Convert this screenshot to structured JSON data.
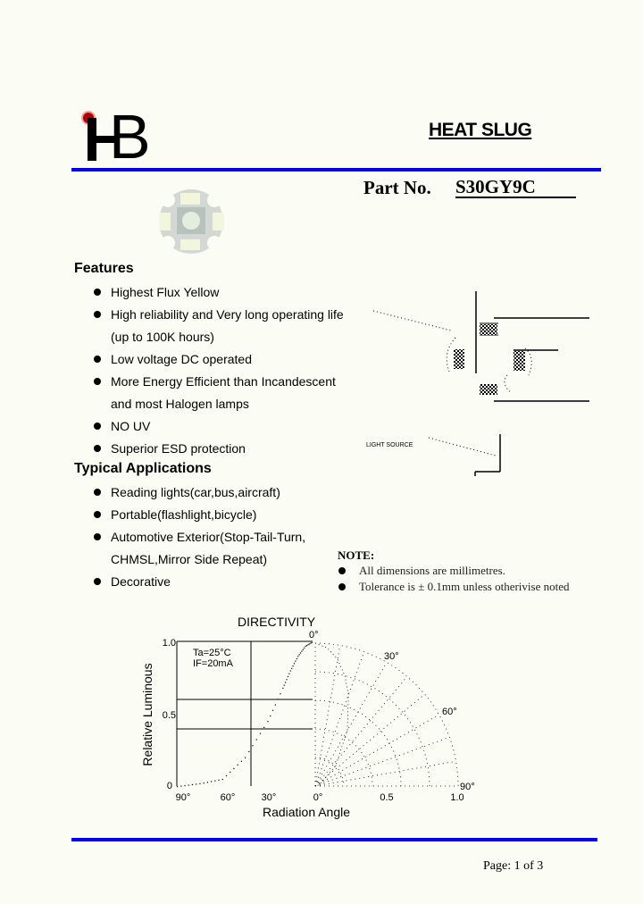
{
  "header": {
    "logo_text": "HB",
    "title": "HEAT SLUG",
    "part_label": "Part  No.",
    "part_number": "S30GY9C",
    "colors": {
      "rule": "#0000f0",
      "logo_sun": "#b00000",
      "background": "#fbfcf3"
    }
  },
  "product_image": {
    "icon": "led-star-board-image"
  },
  "features": {
    "heading": "Features",
    "items": [
      "Highest Flux Yellow",
      "High reliability and Very long operating life",
      "(up to 100K hours)",
      "Low voltage DC operated",
      "More Energy Efficient than Incandescent",
      "and most Halogen lamps",
      "NO UV",
      "Superior ESD protection"
    ],
    "bulleted": [
      true,
      true,
      false,
      true,
      true,
      false,
      true,
      true
    ]
  },
  "applications": {
    "heading": "Typical Applications",
    "items": [
      "Reading lights(car,bus,aircraft)",
      "Portable(flashlight,bicycle)",
      "Automotive Exterior(Stop-Tail-Turn,",
      "CHMSL,Mirror Side Repeat)",
      "Decorative"
    ],
    "bulleted": [
      true,
      true,
      true,
      false,
      true
    ]
  },
  "drawing": {
    "labels": [
      "LIGHT SOURCE"
    ]
  },
  "note": {
    "heading": "NOTE:",
    "items": [
      "All dimensions are millimetres.",
      "Tolerance is ± 0.1mm unless otherivise noted"
    ]
  },
  "chart_data": {
    "type": "line",
    "title": "DIRECTIVITY",
    "xlabel": "Radiation Angle",
    "ylabel": "Relative Luminous",
    "conditions": [
      "Ta=25°C",
      "IF=20mA"
    ],
    "left_panel": {
      "x_ticks": [
        "90°",
        "60°",
        "30°",
        "0°"
      ],
      "y_ticks": [
        "0",
        "0.5",
        "1.0"
      ],
      "ylim": [
        0,
        1.0
      ],
      "series": [
        {
          "name": "relative luminous vs angle",
          "angle_deg": [
            90,
            75,
            60,
            45,
            30,
            20,
            15,
            10,
            5,
            0
          ],
          "value": [
            0,
            0.02,
            0.05,
            0.2,
            0.45,
            0.68,
            0.8,
            0.9,
            0.97,
            1.0
          ]
        }
      ]
    },
    "polar_panel": {
      "angle_labels": [
        "0°",
        "30°",
        "60°",
        "90°"
      ],
      "radial_ticks": [
        "0°",
        "0.5",
        "1.0"
      ]
    }
  },
  "footer": {
    "page": "Page: 1 of 3"
  }
}
